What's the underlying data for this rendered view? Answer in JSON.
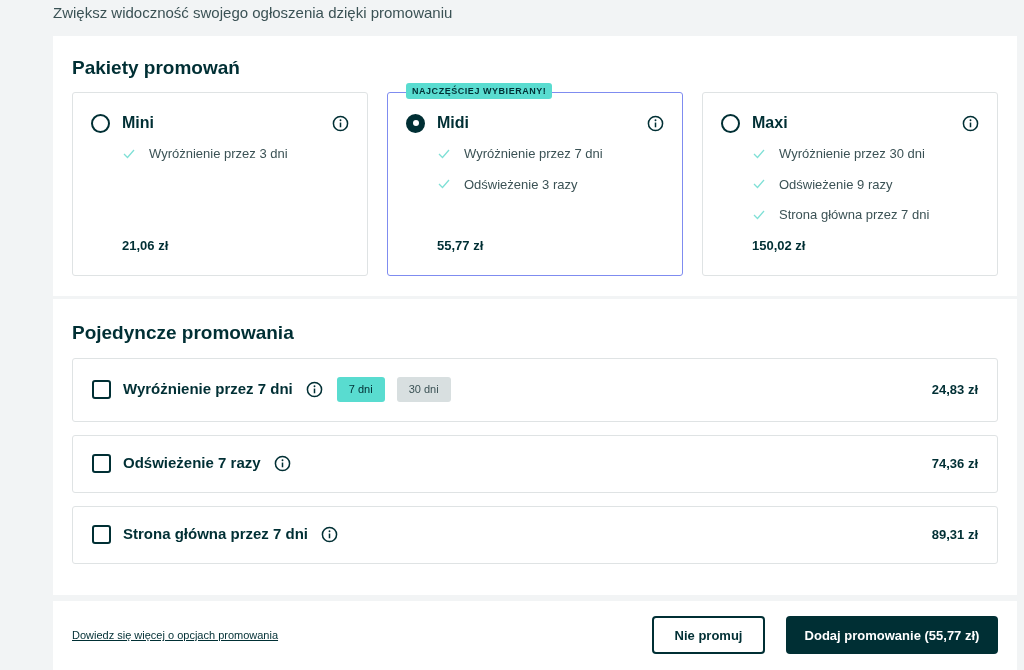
{
  "subtitle": "Zwiększ widoczność swojego ogłoszenia dzięki promowaniu",
  "packages": {
    "title": "Pakiety promowań",
    "items": [
      {
        "name": "Mini",
        "selected": false,
        "features": [
          "Wyróżnienie przez 3 dni"
        ],
        "price": "21,06 zł"
      },
      {
        "name": "Midi",
        "selected": true,
        "badge": "NAJCZĘŚCIEJ WYBIERANY!",
        "features": [
          "Wyróżnienie przez 7 dni",
          "Odświeżenie 3 razy"
        ],
        "price": "55,77 zł"
      },
      {
        "name": "Maxi",
        "selected": false,
        "features": [
          "Wyróżnienie przez 30 dni",
          "Odświeżenie 9 razy",
          "Strona główna przez 7 dni"
        ],
        "price": "150,02 zł"
      }
    ]
  },
  "singles": {
    "title": "Pojedyncze promowania",
    "items": [
      {
        "name": "Wyróżnienie przez 7 dni",
        "checked": false,
        "options": [
          {
            "label": "7 dni",
            "selected": true
          },
          {
            "label": "30 dni",
            "selected": false
          }
        ],
        "price": "24,83 zł"
      },
      {
        "name": "Odświeżenie 7 razy",
        "checked": false,
        "price": "74,36 zł"
      },
      {
        "name": "Strona główna przez 7 dni",
        "checked": false,
        "price": "89,31 zł"
      }
    ]
  },
  "footer": {
    "link": "Dowiedz się więcej o opcjach promowania",
    "secondary_button": "Nie promuj",
    "primary_button": "Dodaj promowanie (55,77 zł)"
  }
}
